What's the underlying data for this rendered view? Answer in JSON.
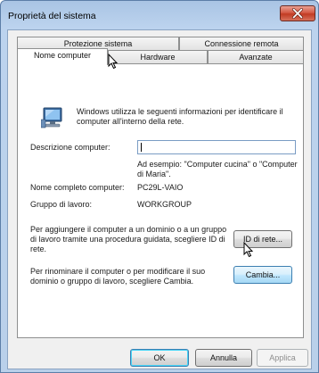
{
  "window": {
    "title": "Proprietà del sistema"
  },
  "tabs": {
    "row_back": [
      "Protezione sistema",
      "Connessione remota"
    ],
    "row_front": [
      "Nome computer",
      "Hardware",
      "Avanzate"
    ],
    "active": "Nome computer"
  },
  "panel": {
    "intro": "Windows utilizza le seguenti informazioni per identificare il computer all'interno della rete.",
    "description_label": "Descrizione computer:",
    "description_value": "",
    "description_example": "Ad esempio: \"Computer cucina\" o \"Computer di Maria\".",
    "full_name_label": "Nome completo computer:",
    "full_name_value": "PC29L-VAIO",
    "workgroup_label": "Gruppo di lavoro:",
    "workgroup_value": "WORKGROUP",
    "domain_text": "Per aggiungere il computer a un dominio o a un gruppo di lavoro tramite una procedura guidata, scegliere ID di rete.",
    "network_id_button": "ID di rete...",
    "rename_text": "Per rinominare il computer o per modificare il suo dominio o gruppo di lavoro, scegliere Cambia.",
    "change_button": "Cambia..."
  },
  "footer": {
    "ok": "OK",
    "cancel": "Annulla",
    "apply": "Applica"
  },
  "colors": {
    "titlebar": "#b9d0ea",
    "close_button": "#c13b23",
    "hover_button": "#bee6fd"
  },
  "icons": [
    "close-icon",
    "computer-monitor-icon",
    "mouse-pointer-icon"
  ]
}
